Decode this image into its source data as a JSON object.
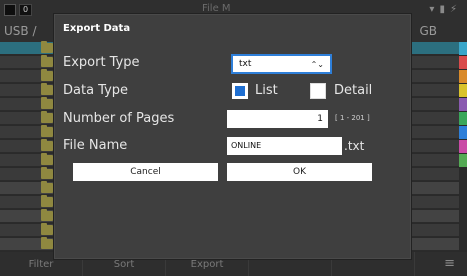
{
  "background": {
    "status_badge": "0",
    "path": "USB /",
    "title": "File M",
    "size_label": "GB",
    "rows": 15,
    "bottom_tabs": [
      "Filter",
      "Sort",
      "Export",
      "",
      ""
    ],
    "menu_icon": "list-icon",
    "strip_colors": [
      "#3aa6c9",
      "#d94b4b",
      "#d98a2a",
      "#d9c22a",
      "#8a5ab0",
      "#3aa65a",
      "#2e7fd9",
      "#c94ba6",
      "#55aa55"
    ]
  },
  "dialog": {
    "title": "Export Data",
    "export_type": {
      "label": "Export Type",
      "value": "txt"
    },
    "data_type": {
      "label": "Data Type",
      "options": [
        {
          "label": "List",
          "checked": true
        },
        {
          "label": "Detail",
          "checked": false
        }
      ]
    },
    "pages": {
      "label": "Number of Pages",
      "value": "1",
      "range": "[ 1 - 201 ]"
    },
    "file_name": {
      "label": "File Name",
      "value": "ONLINE",
      "extension": ".txt"
    },
    "buttons": {
      "cancel": "Cancel",
      "ok": "OK"
    }
  }
}
